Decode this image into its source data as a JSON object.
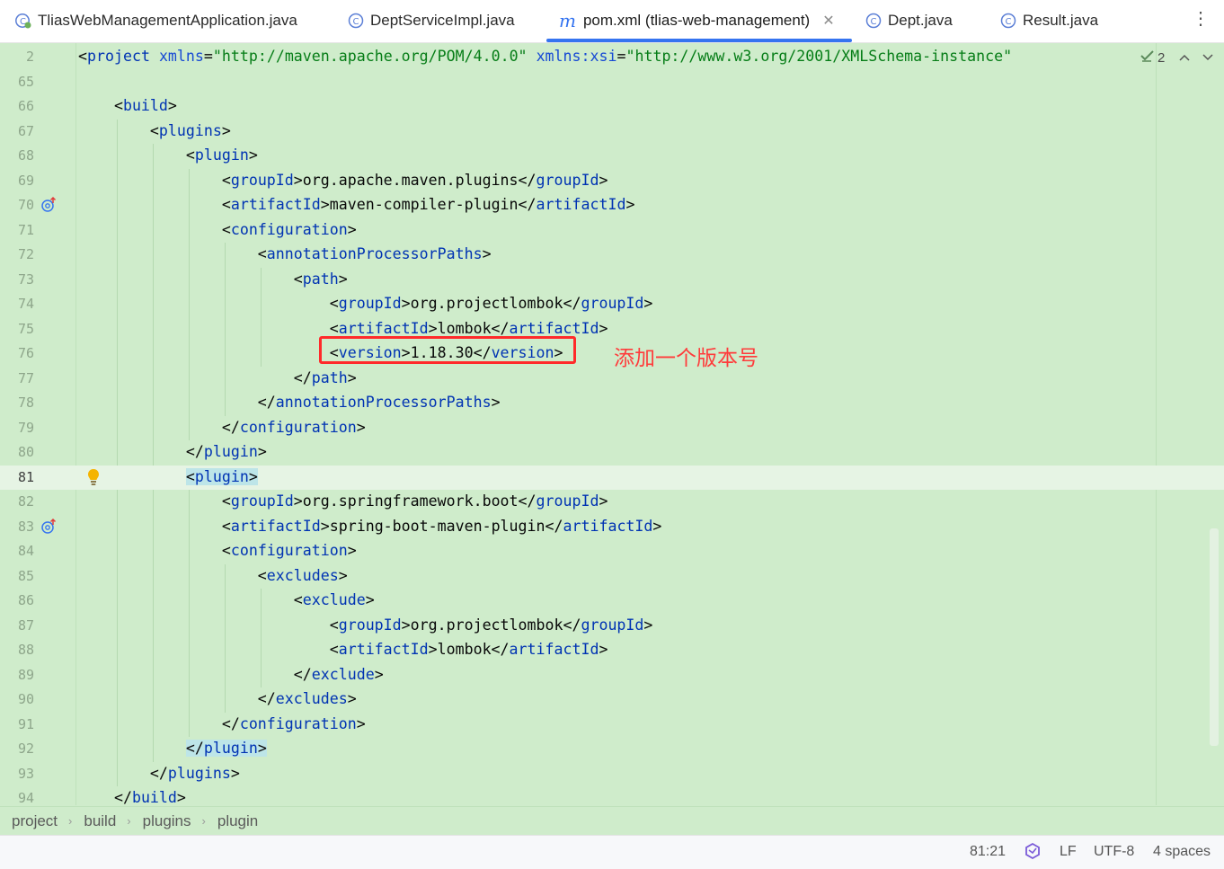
{
  "tabs": [
    {
      "label": "TliasWebManagementApplication.java",
      "icon": "spring-boot-class-icon"
    },
    {
      "label": "DeptServiceImpl.java",
      "icon": "class-icon"
    },
    {
      "label": "pom.xml (tlias-web-management)",
      "icon": "maven-icon",
      "active": true
    },
    {
      "label": "Dept.java",
      "icon": "class-icon"
    },
    {
      "label": "Result.java",
      "icon": "class-icon"
    }
  ],
  "inspections": {
    "count": "2"
  },
  "lines": [
    {
      "n": "2",
      "text": "<project xmlns=\"http://maven.apache.org/POM/4.0.0\" xmlns:xsi=\"http://www.w3.org/2001/XMLSchema-instance\""
    },
    {
      "n": "65",
      "text": ""
    },
    {
      "n": "66",
      "text": "    <build>"
    },
    {
      "n": "67",
      "text": "        <plugins>"
    },
    {
      "n": "68",
      "text": "            <plugin>"
    },
    {
      "n": "69",
      "text": "                <groupId>org.apache.maven.plugins</groupId>"
    },
    {
      "n": "70",
      "text": "                <artifactId>maven-compiler-plugin</artifactId>"
    },
    {
      "n": "71",
      "text": "                <configuration>"
    },
    {
      "n": "72",
      "text": "                    <annotationProcessorPaths>"
    },
    {
      "n": "73",
      "text": "                        <path>"
    },
    {
      "n": "74",
      "text": "                            <groupId>org.projectlombok</groupId>"
    },
    {
      "n": "75",
      "text": "                            <artifactId>lombok</artifactId>"
    },
    {
      "n": "76",
      "text": "                            <version>1.18.30</version>"
    },
    {
      "n": "77",
      "text": "                        </path>"
    },
    {
      "n": "78",
      "text": "                    </annotationProcessorPaths>"
    },
    {
      "n": "79",
      "text": "                </configuration>"
    },
    {
      "n": "80",
      "text": "            </plugin>"
    },
    {
      "n": "81",
      "text": "            <plugin>"
    },
    {
      "n": "82",
      "text": "                <groupId>org.springframework.boot</groupId>"
    },
    {
      "n": "83",
      "text": "                <artifactId>spring-boot-maven-plugin</artifactId>"
    },
    {
      "n": "84",
      "text": "                <configuration>"
    },
    {
      "n": "85",
      "text": "                    <excludes>"
    },
    {
      "n": "86",
      "text": "                        <exclude>"
    },
    {
      "n": "87",
      "text": "                            <groupId>org.projectlombok</groupId>"
    },
    {
      "n": "88",
      "text": "                            <artifactId>lombok</artifactId>"
    },
    {
      "n": "89",
      "text": "                        </exclude>"
    },
    {
      "n": "90",
      "text": "                    </excludes>"
    },
    {
      "n": "91",
      "text": "                </configuration>"
    },
    {
      "n": "92",
      "text": "            </plugin>"
    },
    {
      "n": "93",
      "text": "        </plugins>"
    },
    {
      "n": "94",
      "text": "    </build>"
    }
  ],
  "current_line": "81",
  "annotation": {
    "text": "添加一个版本号"
  },
  "breadcrumb": [
    "project",
    "build",
    "plugins",
    "plugin"
  ],
  "status": {
    "position": "81:21",
    "line_ending": "LF",
    "encoding": "UTF-8",
    "indent": "4 spaces"
  },
  "colors": {
    "editor_bg": "#cfeccb",
    "tag": "#0033b3",
    "attr_value": "#067d17",
    "annotation": "#ff3b3b",
    "accent": "#3574f0"
  }
}
